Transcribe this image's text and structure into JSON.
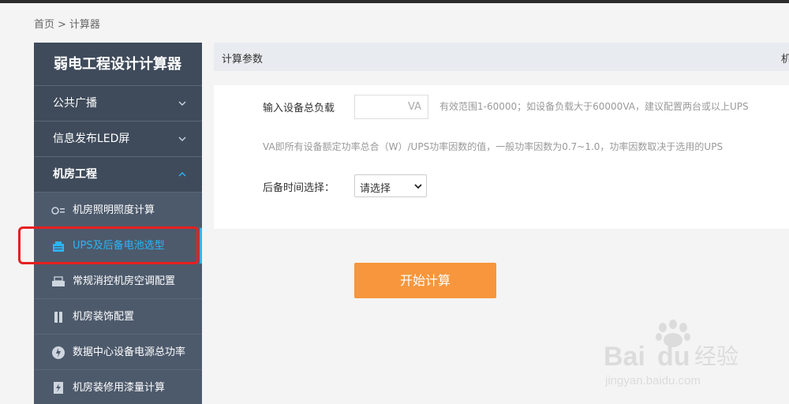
{
  "breadcrumb": {
    "home": "首页",
    "separator": ">",
    "current": "计算器"
  },
  "sidebar": {
    "title": "弱电工程设计计算器",
    "groups": [
      {
        "label": "公共广播",
        "icon": "chevron-down-icon"
      },
      {
        "label": "信息发布LED屏",
        "icon": "chevron-down-icon"
      },
      {
        "label": "机房工程",
        "icon": "chevron-up-icon"
      }
    ],
    "items": [
      {
        "label": "机房照明照度计算",
        "icon": "lighting-icon"
      },
      {
        "label": "UPS及后备电池选型",
        "icon": "ups-battery-icon"
      },
      {
        "label": "常规消控机房空调配置",
        "icon": "air-conditioner-icon"
      },
      {
        "label": "机房装饰配置",
        "icon": "decoration-icon"
      },
      {
        "label": "数据中心设备电源总功率",
        "icon": "globe-power-icon"
      },
      {
        "label": "机房装修用漆量计算",
        "icon": "paint-icon"
      }
    ]
  },
  "panel": {
    "header": "计算参数",
    "header_right": "机",
    "load_label": "输入设备总负载",
    "load_unit": "VA",
    "load_hint": "有效范围1-60000；如设备负载大于60000VA，建议配置两台或以上UPS",
    "load_desc": "VA即所有设备额定功率总合（W）/UPS功率因数的值，一般功率因数为0.7~1.0，功率因数取决于选用的UPS",
    "backup_label": "后备时间选择：",
    "backup_selected": "请选择"
  },
  "calc_button": "开始计算",
  "watermark": {
    "brand": "Bai",
    "brand2": "du",
    "suffix": "经验",
    "url": "jingyan.baidu.com"
  },
  "colors": {
    "sidebar": "#3f4b5b",
    "accent": "#29b6f6",
    "button": "#f7963c",
    "highlight": "#e62020"
  }
}
